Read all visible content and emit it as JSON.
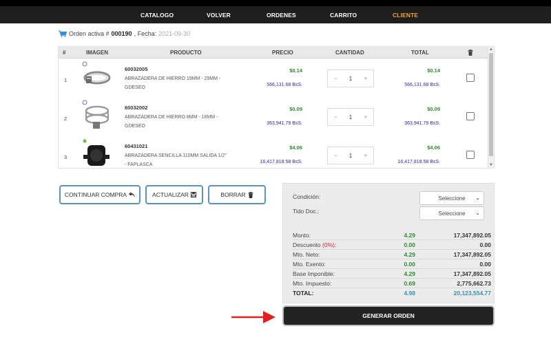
{
  "nav": {
    "items": [
      {
        "label": "CATALOGO"
      },
      {
        "label": "VOLVER"
      },
      {
        "label": "ORDENES"
      },
      {
        "label": "CARRITO"
      },
      {
        "label": "CLIENTE"
      }
    ],
    "active_color": "#f5a623"
  },
  "order": {
    "prefix": "Orden activa #",
    "number": "000190",
    "date_label": ", Fecha:",
    "date": "2021-09-30"
  },
  "table": {
    "headers": {
      "idx": "#",
      "image": "IMAGEN",
      "product": "PRODUCTO",
      "price": "PRECIO",
      "qty": "CANTIDAD",
      "total": "TOTAL",
      "delete_icon": "trash-icon"
    },
    "rows": [
      {
        "idx": "1",
        "code": "60032005",
        "name": "ABRAZADERA DE HIERRO 19MM - 29MM - GDESEO",
        "price_usd": "$0.14",
        "price_bss": "566,131.68 BsS.",
        "qty": "1",
        "total_usd": "$0.14",
        "total_bss": "566,131.68 BsS."
      },
      {
        "idx": "2",
        "code": "60032002",
        "name": "ABRAZADERA DE HIERRO 8MM - 16MM - GDESEO",
        "price_usd": "$0.09",
        "price_bss": "363,941.79 BsS.",
        "qty": "1",
        "total_usd": "$0.09",
        "total_bss": "363,941.79 BsS."
      },
      {
        "idx": "3",
        "code": "60431021",
        "name": "ABRAZADERA SENCILLA 110MM SALIDA 1/2\" - FAPLASCA",
        "price_usd": "$4.06",
        "price_bss": "16,417,818.58 BsS.",
        "qty": "1",
        "total_usd": "$4.06",
        "total_bss": "16,417,818.58 BsS."
      }
    ],
    "qty_minus": "−",
    "qty_plus": "+"
  },
  "buttons": {
    "continue": "CONTINUAR COMPRA",
    "update": "ACTUALIZAR",
    "delete": "BORRAR",
    "generate": "GENERAR ORDEN"
  },
  "summary": {
    "condition_label": "Condición:",
    "condition_value": "Seleccione",
    "doc_label": "Tido Doc.:",
    "doc_value": "Seleccione",
    "rows": [
      {
        "label": "Monto:",
        "usd": "4.29",
        "bss": "17,347,892.05"
      },
      {
        "label": "Descuento",
        "pct": "(0%)",
        "suffix": ":",
        "usd": "0.00",
        "bss": "0.00"
      },
      {
        "label": "Mto. Neto:",
        "usd": "4.29",
        "bss": "17,347,892.05"
      },
      {
        "label": "Mto. Exento:",
        "usd": "0.00",
        "bss": "0.00"
      },
      {
        "label": "Base Imponible:",
        "usd": "4.29",
        "bss": "17,347,892.05"
      },
      {
        "label": "Mto. Impuesto:",
        "usd": "0.69",
        "bss": "2,775,662.73"
      },
      {
        "label": "TOTAL:",
        "usd": "4.98",
        "bss": "20,123,554.77"
      }
    ]
  },
  "colors": {
    "usd_green": "#2e8b2e",
    "bss_blue": "#2a2ab5",
    "accent_red": "#e02020",
    "button_border": "#5b92b5"
  }
}
